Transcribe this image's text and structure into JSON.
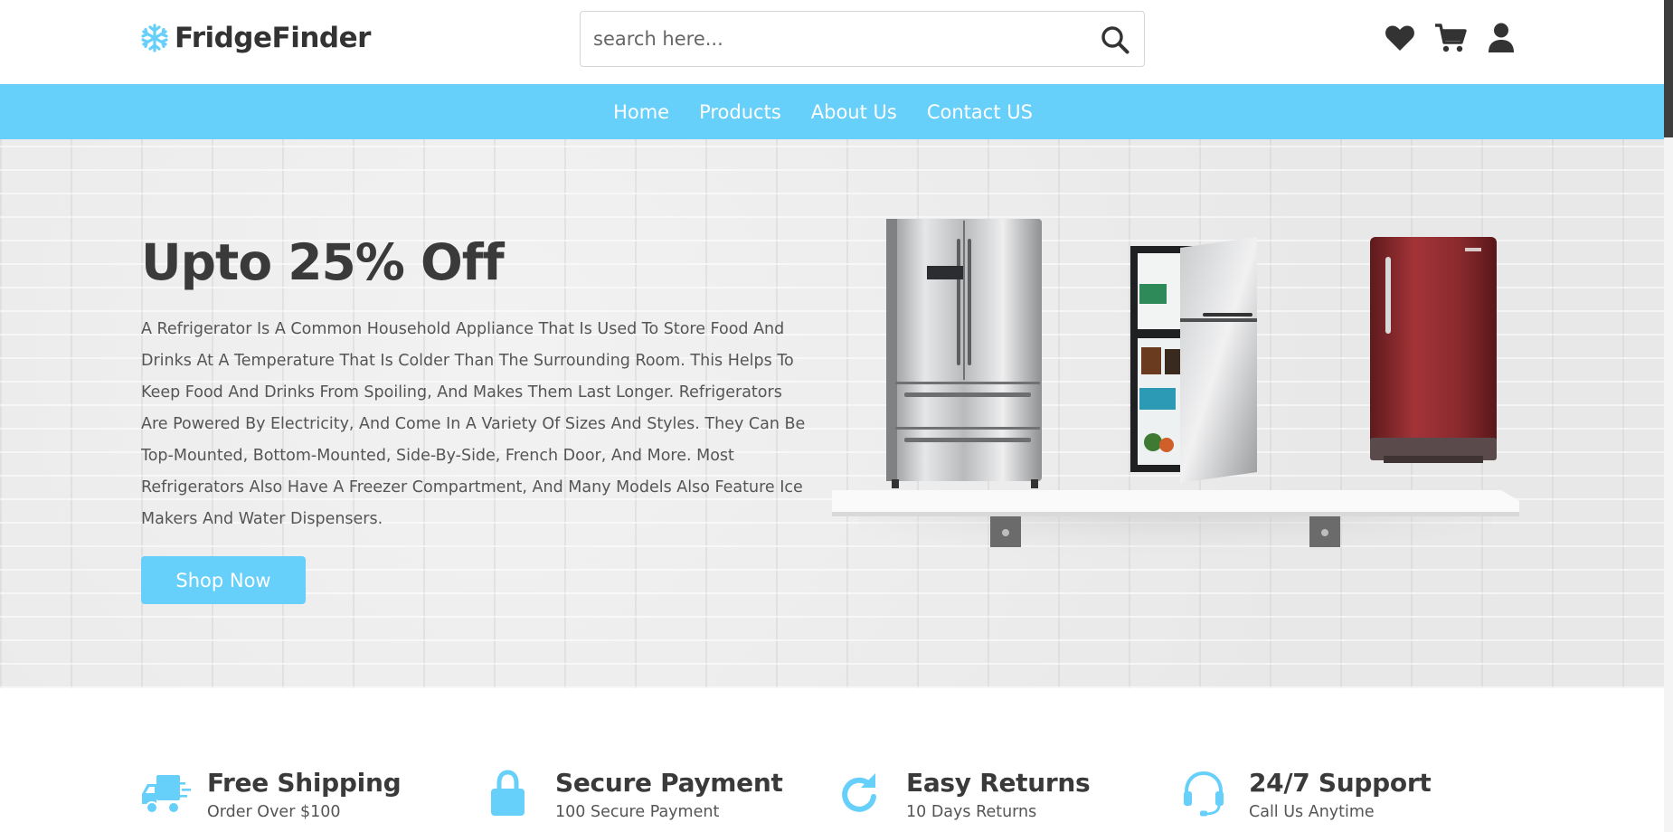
{
  "brand": {
    "name": "FridgeFinder",
    "icon": "snowflake-icon",
    "accent_color": "#66cffa"
  },
  "search": {
    "placeholder": "search here...",
    "button_icon": "search-icon"
  },
  "header_icons": [
    {
      "name": "heart-icon",
      "label": "Wishlist"
    },
    {
      "name": "cart-icon",
      "label": "Cart"
    },
    {
      "name": "user-icon",
      "label": "Account"
    }
  ],
  "nav": {
    "items": [
      {
        "label": "Home"
      },
      {
        "label": "Products"
      },
      {
        "label": "About Us"
      },
      {
        "label": "Contact US"
      }
    ]
  },
  "hero": {
    "title": "Upto 25% Off",
    "description": "A Refrigerator Is A Common Household Appliance That Is Used To Store Food And Drinks At A Temperature That Is Colder Than The Surrounding Room. This Helps To Keep Food And Drinks From Spoiling, And Makes Them Last Longer. Refrigerators Are Powered By Electricity, And Come In A Variety Of Sizes And Styles. They Can Be Top-Mounted, Bottom-Mounted, Side-By-Side, French Door, And More. Most Refrigerators Also Have A Freezer Compartment, And Many Models Also Feature Ice Makers And Water Dispensers.",
    "cta_label": "Shop Now",
    "image": "refrigerators-on-shelf"
  },
  "features": [
    {
      "icon": "truck-icon",
      "title": "Free Shipping",
      "subtitle": "Order Over $100"
    },
    {
      "icon": "lock-icon",
      "title": "Secure Payment",
      "subtitle": "100 Secure Payment"
    },
    {
      "icon": "redo-icon",
      "title": "Easy Returns",
      "subtitle": "10 Days Returns"
    },
    {
      "icon": "headset-icon",
      "title": "24/7 Support",
      "subtitle": "Call Us Anytime"
    }
  ]
}
